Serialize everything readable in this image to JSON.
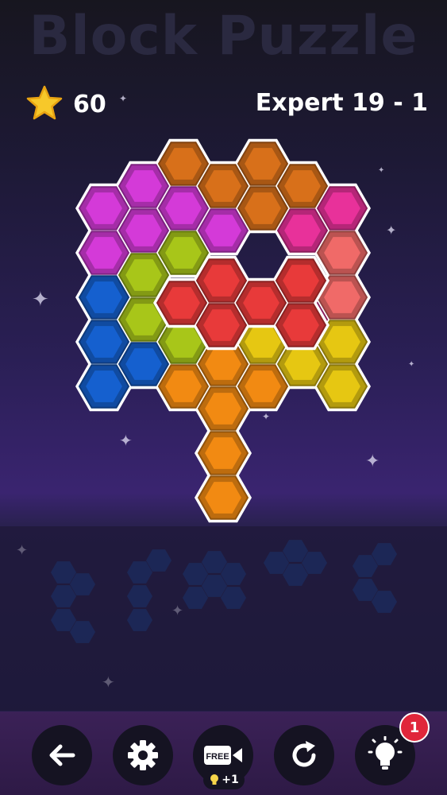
{
  "header": {
    "title": "Block Puzzle",
    "score": "60",
    "level": "Expert 19 - 1"
  },
  "toolbar": {
    "back": "back-arrow-icon",
    "settings": "gear-icon",
    "free_label": "FREE",
    "video": "video-camera-icon",
    "restart": "restart-icon",
    "hint": "lightbulb-icon",
    "hint_badge": "1",
    "bonus": "+1"
  },
  "colors": {
    "orange_dark": "#d8701a",
    "magenta": "#d43ad8",
    "pink": "#e8319a",
    "lime": "#a8c619",
    "blue": "#1560cf",
    "salmon": "#f06a68",
    "yellow": "#e6c712",
    "orange": "#f28a12",
    "red": "#e83a3a"
  },
  "board": {
    "cells": [
      {
        "c": 2,
        "r": 0,
        "color": "orange_dark"
      },
      {
        "c": 4,
        "r": 0,
        "color": "orange_dark"
      },
      {
        "c": 1,
        "r": 0.5,
        "color": "magenta"
      },
      {
        "c": 3,
        "r": 0.5,
        "color": "orange_dark"
      },
      {
        "c": 5,
        "r": 0.5,
        "color": "orange_dark"
      },
      {
        "c": 0,
        "r": 1,
        "color": "magenta"
      },
      {
        "c": 2,
        "r": 1,
        "color": "magenta"
      },
      {
        "c": 4,
        "r": 1,
        "color": "orange_dark"
      },
      {
        "c": 6,
        "r": 1,
        "color": "pink"
      },
      {
        "c": 1,
        "r": 1.5,
        "color": "magenta"
      },
      {
        "c": 3,
        "r": 1.5,
        "color": "magenta"
      },
      {
        "c": 5,
        "r": 1.5,
        "color": "pink"
      },
      {
        "c": 0,
        "r": 2,
        "color": "magenta"
      },
      {
        "c": 2,
        "r": 2,
        "color": "lime"
      },
      {
        "c": 6,
        "r": 2,
        "color": "salmon"
      },
      {
        "c": 1,
        "r": 2.5,
        "color": "lime"
      },
      {
        "c": 0,
        "r": 3,
        "color": "blue"
      },
      {
        "c": 6,
        "r": 3,
        "color": "salmon"
      },
      {
        "c": 1,
        "r": 3.5,
        "color": "lime"
      },
      {
        "c": 5,
        "r": 3.5,
        "color": "pink"
      },
      {
        "c": 0,
        "r": 4,
        "color": "blue"
      },
      {
        "c": 2,
        "r": 4,
        "color": "lime"
      },
      {
        "c": 4,
        "r": 4,
        "color": "yellow"
      },
      {
        "c": 6,
        "r": 4,
        "color": "yellow"
      },
      {
        "c": 1,
        "r": 4.5,
        "color": "blue"
      },
      {
        "c": 3,
        "r": 4.5,
        "color": "orange"
      },
      {
        "c": 5,
        "r": 4.5,
        "color": "yellow"
      },
      {
        "c": 0,
        "r": 5,
        "color": "blue"
      },
      {
        "c": 2,
        "r": 5,
        "color": "orange"
      },
      {
        "c": 4,
        "r": 5,
        "color": "orange"
      },
      {
        "c": 6,
        "r": 5,
        "color": "yellow"
      },
      {
        "c": 3,
        "r": 5.5,
        "color": "orange"
      },
      {
        "c": 3,
        "r": 6.5,
        "color": "orange"
      },
      {
        "c": 3,
        "r": 7.5,
        "color": "orange"
      }
    ],
    "dragging_piece": [
      {
        "c": 3,
        "r": 2.5,
        "color": "red"
      },
      {
        "c": 5,
        "r": 2.5,
        "color": "red"
      },
      {
        "c": 2,
        "r": 3,
        "color": "red"
      },
      {
        "c": 4,
        "r": 3,
        "color": "red"
      },
      {
        "c": 3,
        "r": 3.5,
        "color": "red"
      },
      {
        "c": 5,
        "r": 3.5,
        "color": "red"
      }
    ]
  },
  "tray": {
    "pieces": [
      {
        "cells": [
          [
            0,
            0
          ],
          [
            1,
            0.5
          ],
          [
            0,
            1
          ],
          [
            0,
            2
          ],
          [
            1,
            2.5
          ]
        ]
      },
      {
        "cells": [
          [
            0,
            0
          ],
          [
            1,
            -0.5
          ],
          [
            0,
            1
          ],
          [
            0,
            2
          ]
        ]
      },
      {
        "cells": [
          [
            0,
            0
          ],
          [
            1,
            -0.5
          ],
          [
            2,
            0
          ],
          [
            1,
            0.5
          ],
          [
            2,
            1
          ],
          [
            0,
            1
          ]
        ]
      },
      {
        "cells": [
          [
            0,
            0
          ],
          [
            1,
            -0.5
          ],
          [
            2,
            0
          ],
          [
            1,
            0.5
          ]
        ]
      },
      {
        "cells": [
          [
            0,
            0
          ],
          [
            1,
            -0.5
          ],
          [
            0,
            1
          ],
          [
            1,
            1.5
          ]
        ]
      }
    ]
  }
}
